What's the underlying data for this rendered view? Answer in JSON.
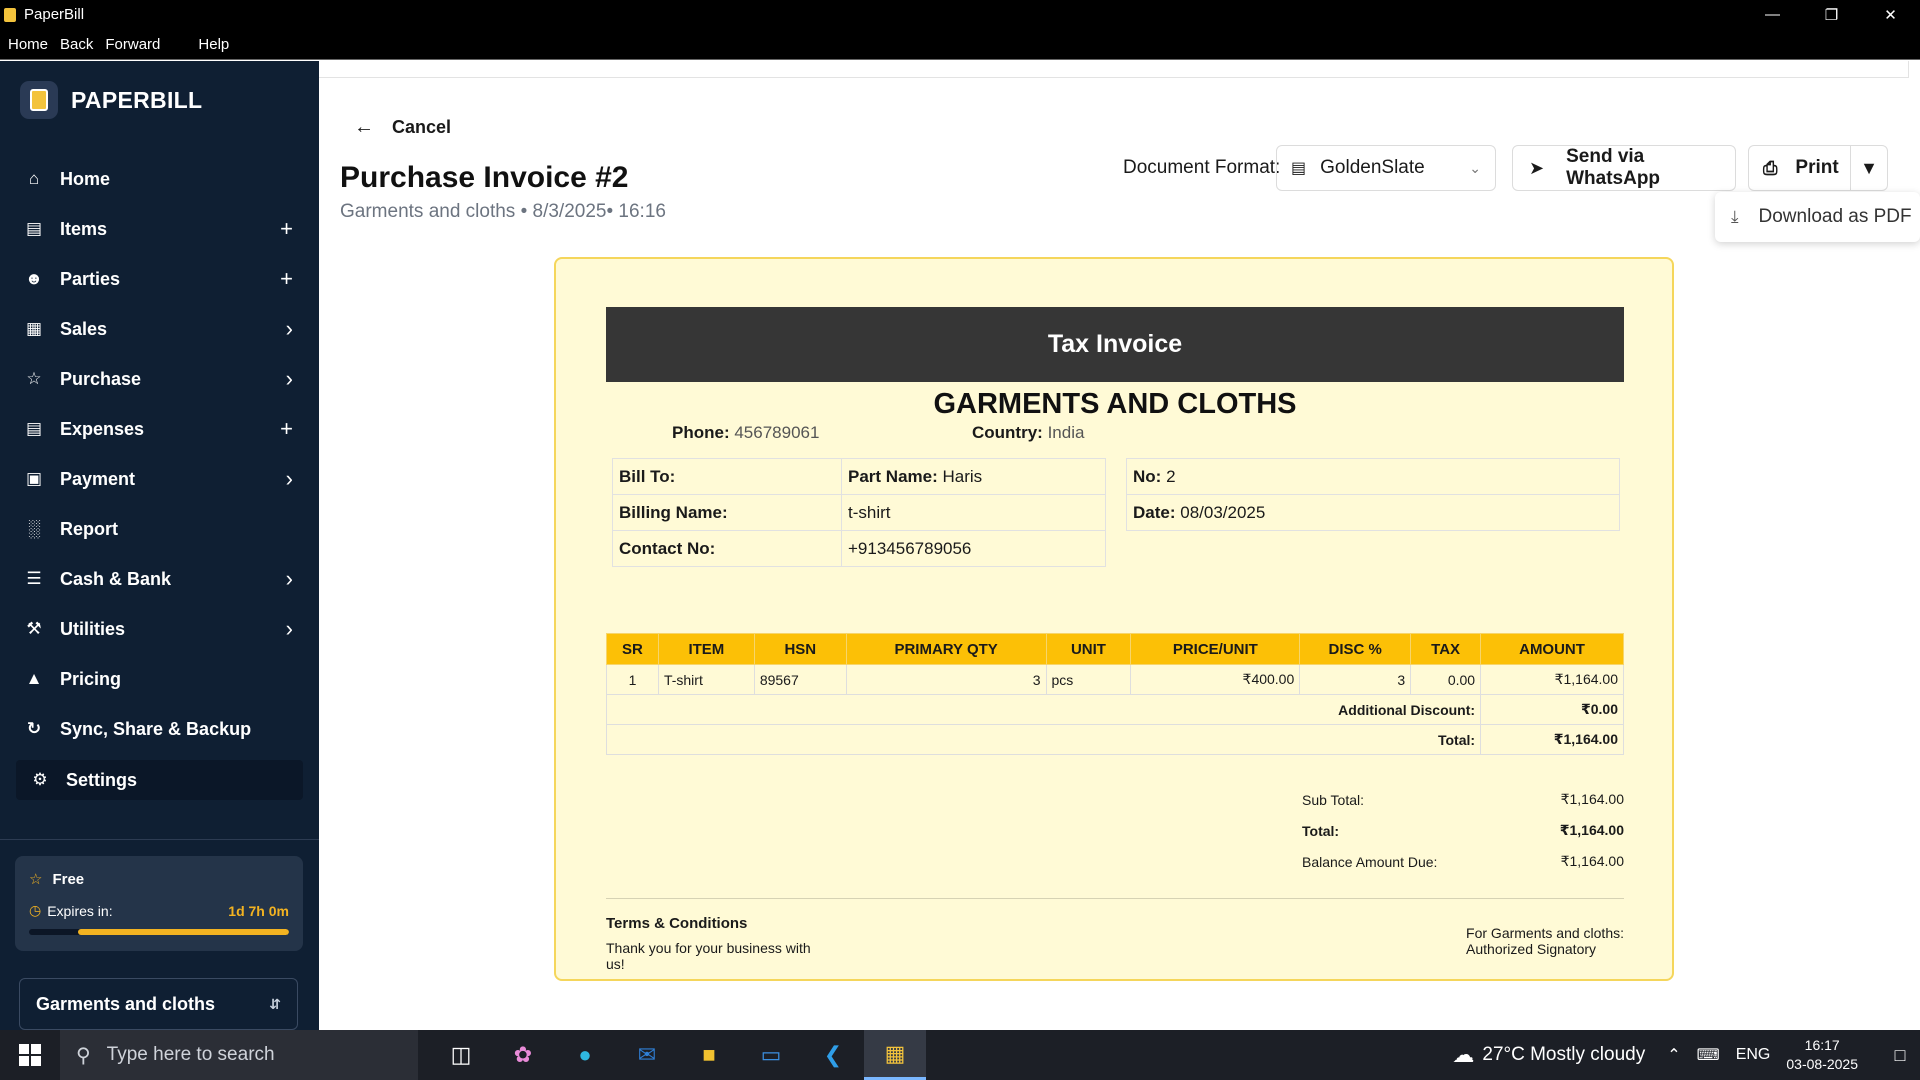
{
  "window": {
    "title": "PaperBill"
  },
  "menu": {
    "home": "Home",
    "back": "Back",
    "forward": "Forward",
    "help": "Help"
  },
  "sidebar": {
    "brand": "PAPERBILL",
    "items": [
      {
        "label": "Home",
        "icon": "home-icon",
        "trail": ""
      },
      {
        "label": "Items",
        "icon": "box-icon",
        "trail": "+"
      },
      {
        "label": "Parties",
        "icon": "users-icon",
        "trail": "+"
      },
      {
        "label": "Sales",
        "icon": "receipt-icon",
        "trail": "›"
      },
      {
        "label": "Purchase",
        "icon": "cart-icon",
        "trail": "›"
      },
      {
        "label": "Expenses",
        "icon": "expense-icon",
        "trail": "+"
      },
      {
        "label": "Payment",
        "icon": "wallet-icon",
        "trail": "›"
      },
      {
        "label": "Report",
        "icon": "chart-icon",
        "trail": ""
      },
      {
        "label": "Cash & Bank",
        "icon": "bank-icon",
        "trail": "›"
      },
      {
        "label": "Utilities",
        "icon": "wrench-icon",
        "trail": "›"
      },
      {
        "label": "Pricing",
        "icon": "basket-icon",
        "trail": ""
      },
      {
        "label": "Sync, Share & Backup",
        "icon": "sync-icon",
        "trail": ""
      },
      {
        "label": "Settings",
        "icon": "gear-icon",
        "trail": ""
      }
    ],
    "plan": {
      "name": "Free",
      "expires_label": "Expires in:",
      "expires_value": "1d 7h 0m",
      "remaining_fraction": 0.81
    },
    "business": "Garments and cloths"
  },
  "header": {
    "cancel": "Cancel",
    "title": "Purchase Invoice #2",
    "subtitle": "Garments and cloths • 8/3/2025• 16:16",
    "format_label": "Document Format:",
    "format_value": "GoldenSlate",
    "whatsapp": "Send via WhatsApp",
    "print": "Print",
    "download_pdf": "Download as PDF"
  },
  "invoice": {
    "heading": "Tax Invoice",
    "company": "GARMENTS AND CLOTHS",
    "phone_label": "Phone:",
    "phone": "456789061",
    "country_label": "Country:",
    "country": "India",
    "bill": {
      "bill_to_label": "Bill To:",
      "part_name_label": "Part Name:",
      "part_name": "Haris",
      "billing_name_label": "Billing Name:",
      "billing_name": "t-shirt",
      "contact_label": "Contact No:",
      "contact": "+913456789056"
    },
    "no_label": "No:",
    "no": "2",
    "date_label": "Date:",
    "date": "08/03/2025",
    "columns": [
      "SR",
      "ITEM",
      "HSN",
      "PRIMARY QTY",
      "UNIT",
      "PRICE/UNIT",
      "DISC %",
      "TAX",
      "AMOUNT"
    ],
    "rows": [
      {
        "sr": "1",
        "item": "T-shirt",
        "hsn": "89567",
        "qty": "3",
        "unit": "pcs",
        "price": "₹400.00",
        "disc": "3",
        "tax": "0.00",
        "amount": "₹1,164.00"
      }
    ],
    "additional_discount_label": "Additional Discount:",
    "additional_discount": "₹0.00",
    "total_label": "Total:",
    "total": "₹1,164.00",
    "summary": {
      "sub_total_label": "Sub Total:",
      "sub_total": "₹1,164.00",
      "total_label": "Total:",
      "total": "₹1,164.00",
      "balance_label": "Balance Amount Due:",
      "balance": "₹1,164.00"
    },
    "terms_title": "Terms & Conditions",
    "terms_text": "Thank you for your business with us!",
    "sign_line1": "For Garments and cloths:",
    "sign_line2": "Authorized Signatory"
  },
  "taskbar": {
    "search_placeholder": "Type here to search",
    "weather": "27°C  Mostly cloudy",
    "lang": "ENG",
    "time": "16:17",
    "date": "03-08-2025"
  },
  "colors": {
    "sidebar_bg": "#0f1f33",
    "accent": "#fcc006",
    "invoice_bg": "#fffad6"
  }
}
